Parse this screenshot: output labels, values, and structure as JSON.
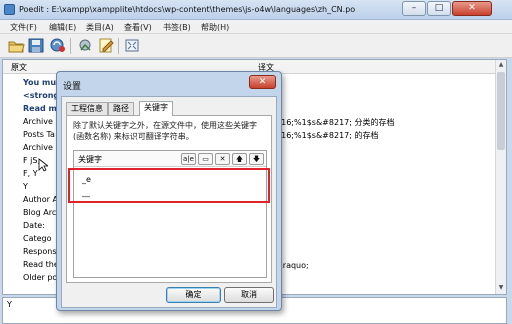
{
  "window": {
    "title": "Poedit : E:\\xampp\\xampplite\\htdocs\\wp-content\\themes\\js-o4w\\languages\\zh_CN.po",
    "controls": {
      "minimize": "–",
      "maximize": "□",
      "close": "✕"
    }
  },
  "menu": [
    "文件(F)",
    "编辑(E)",
    "类目(A)",
    "查看(V)",
    "书签(B)",
    "帮助(H)"
  ],
  "toolbar_icons": [
    "open-folder-icon",
    "save-icon",
    "update-catalog-icon",
    "validate-icon",
    "edit-comment-icon",
    "fullscreen-icon"
  ],
  "list": {
    "col_source": "原文",
    "col_translation": "译文",
    "rows": [
      {
        "src": "You mu",
        "tr": "",
        "bold": true
      },
      {
        "src": "<strong",
        "tr": "",
        "bold": true
      },
      {
        "src": "Read m",
        "tr": "",
        "bold": true
      },
      {
        "src": "Archive",
        "tr": "&#8216;%1$s&#8217; 分类的存档",
        "bold": false
      },
      {
        "src": "Posts Ta",
        "tr": "&#8216;%1$s&#8217; 的存档",
        "bold": false
      },
      {
        "src": "Archive",
        "tr": "存档",
        "bold": false
      },
      {
        "src": "F jS,",
        "tr": "",
        "bold": false
      },
      {
        "src": "F, Y",
        "tr": "",
        "bold": false
      },
      {
        "src": "Y",
        "tr": "",
        "bold": false
      },
      {
        "src": "Author A",
        "tr": "",
        "bold": false
      },
      {
        "src": "Blog Arc",
        "tr": "",
        "bold": false
      },
      {
        "src": "Date:",
        "tr": "",
        "bold": false
      },
      {
        "src": "Catego",
        "tr": "",
        "bold": false
      },
      {
        "src": "Respons",
        "tr": "",
        "bold": false
      },
      {
        "src": "Read the",
        "tr": "全文 &raquo;",
        "bold": false
      },
      {
        "src": "Older po",
        "tr": "",
        "bold": false
      }
    ]
  },
  "bottom_text": "Y",
  "dialog": {
    "title": "设置",
    "close": "✕",
    "tabs": [
      "工程信息",
      "路径",
      "关键字"
    ],
    "description": "除了默认关键字之外，在源文件中，使用这些关键字 (函数名称) 来标识可翻译字符串。",
    "keywords_label": "关键字",
    "keyword_buttons": [
      "a|e",
      "▭",
      "✕",
      "🡅",
      "🡇"
    ],
    "keywords": [
      "_e",
      "__"
    ],
    "ok": "确定",
    "cancel": "取消"
  }
}
